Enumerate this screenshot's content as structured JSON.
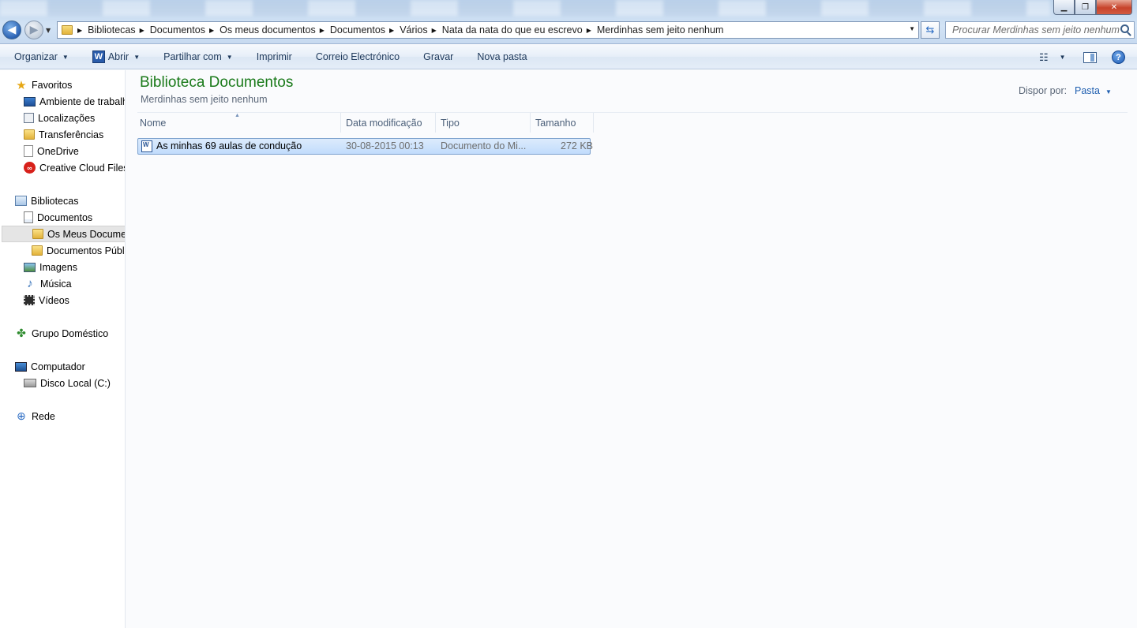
{
  "window": {
    "minimize_label": "▁",
    "maximize_label": "❐",
    "close_label": "✕"
  },
  "addressbar": {
    "breadcrumbs": [
      "Bibliotecas",
      "Documentos",
      "Os meus documentos",
      "Documentos",
      "Vários",
      "Nata da nata do que eu escrevo",
      "Merdinhas sem jeito nenhum"
    ],
    "search_placeholder": "Procurar Merdinhas sem jeito nenhum"
  },
  "toolbar": {
    "organize": "Organizar",
    "open": "Abrir",
    "share": "Partilhar com",
    "print": "Imprimir",
    "email": "Correio Electrónico",
    "burn": "Gravar",
    "new_folder": "Nova pasta"
  },
  "navpane": {
    "favorites": "Favoritos",
    "desktop": "Ambiente de trabalho",
    "locations": "Localizações",
    "downloads": "Transferências",
    "onedrive": "OneDrive",
    "creative_cloud": "Creative Cloud Files",
    "libraries": "Bibliotecas",
    "documents": "Documentos",
    "my_documents": "Os Meus Documentos",
    "public_documents": "Documentos Públicos",
    "images": "Imagens",
    "music": "Música",
    "videos": "Vídeos",
    "homegroup": "Grupo Doméstico",
    "computer": "Computador",
    "local_disk": "Disco Local (C:)",
    "network": "Rede"
  },
  "content": {
    "title": "Biblioteca Documentos",
    "subtitle": "Merdinhas sem jeito nenhum",
    "arrange_label": "Dispor por:",
    "arrange_value": "Pasta",
    "columns": [
      "Nome",
      "Data modificação",
      "Tipo",
      "Tamanho"
    ],
    "files": [
      {
        "name": "As minhas 69 aulas de condução",
        "modified": "30-08-2015 00:13",
        "type": "Documento do Mi...",
        "size": "272 KB"
      }
    ]
  },
  "colors": {
    "accent": "#1f5fb0",
    "library_title": "#1a7a1a",
    "selection": "#c1dcfc"
  }
}
